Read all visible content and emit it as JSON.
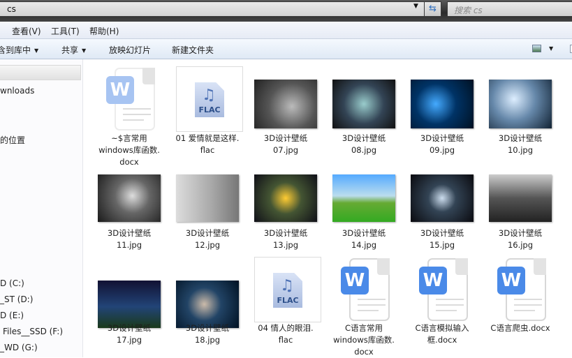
{
  "window": {
    "address": "cs",
    "search_placeholder": "搜索 cs"
  },
  "menu": [
    "查看(V)",
    "工具(T)",
    "帮助(H)"
  ],
  "toolbar": {
    "include_library": "含到库中",
    "share": "共享",
    "slideshow": "放映幻灯片",
    "new_folder": "新建文件夹"
  },
  "sidebar": {
    "items": [
      "wnloads",
      "的位置",
      "D (C:)",
      "_ST (D:)",
      "D (E:)",
      "Files__SSD (F:)",
      "_WD (G:)"
    ]
  },
  "files": [
    {
      "name": "~$言常用\nwindows库函数.\ndocx",
      "type": "docx-temp"
    },
    {
      "name": "01 爱情就是这样.\nflac",
      "type": "flac"
    },
    {
      "name": "3D设计壁纸\n07.jpg",
      "type": "jpg"
    },
    {
      "name": "3D设计壁纸\n08.jpg",
      "type": "jpg"
    },
    {
      "name": "3D设计壁纸\n09.jpg",
      "type": "jpg"
    },
    {
      "name": "3D设计壁纸\n10.jpg",
      "type": "jpg"
    },
    {
      "name": "3D设计壁纸\n11.jpg",
      "type": "jpg"
    },
    {
      "name": "3D设计壁纸\n12.jpg",
      "type": "jpg"
    },
    {
      "name": "3D设计壁纸\n13.jpg",
      "type": "jpg"
    },
    {
      "name": "3D设计壁纸\n14.jpg",
      "type": "jpg"
    },
    {
      "name": "3D设计壁纸\n15.jpg",
      "type": "jpg"
    },
    {
      "name": "3D设计壁纸\n16.jpg",
      "type": "jpg"
    },
    {
      "name": "3D设计壁纸\n17.jpg",
      "type": "jpg"
    },
    {
      "name": "3D设计壁纸\n18.jpg",
      "type": "jpg"
    },
    {
      "name": "04 情人的眼泪.\nflac",
      "type": "flac"
    },
    {
      "name": "C语言常用\nwindows库函数.\ndocx",
      "type": "docx"
    },
    {
      "name": "C语言模拟输入\n框.docx",
      "type": "docx"
    },
    {
      "name": "C语言爬虫.docx",
      "type": "docx"
    }
  ],
  "icon_labels": {
    "flac": "FLAC",
    "word": "W"
  }
}
